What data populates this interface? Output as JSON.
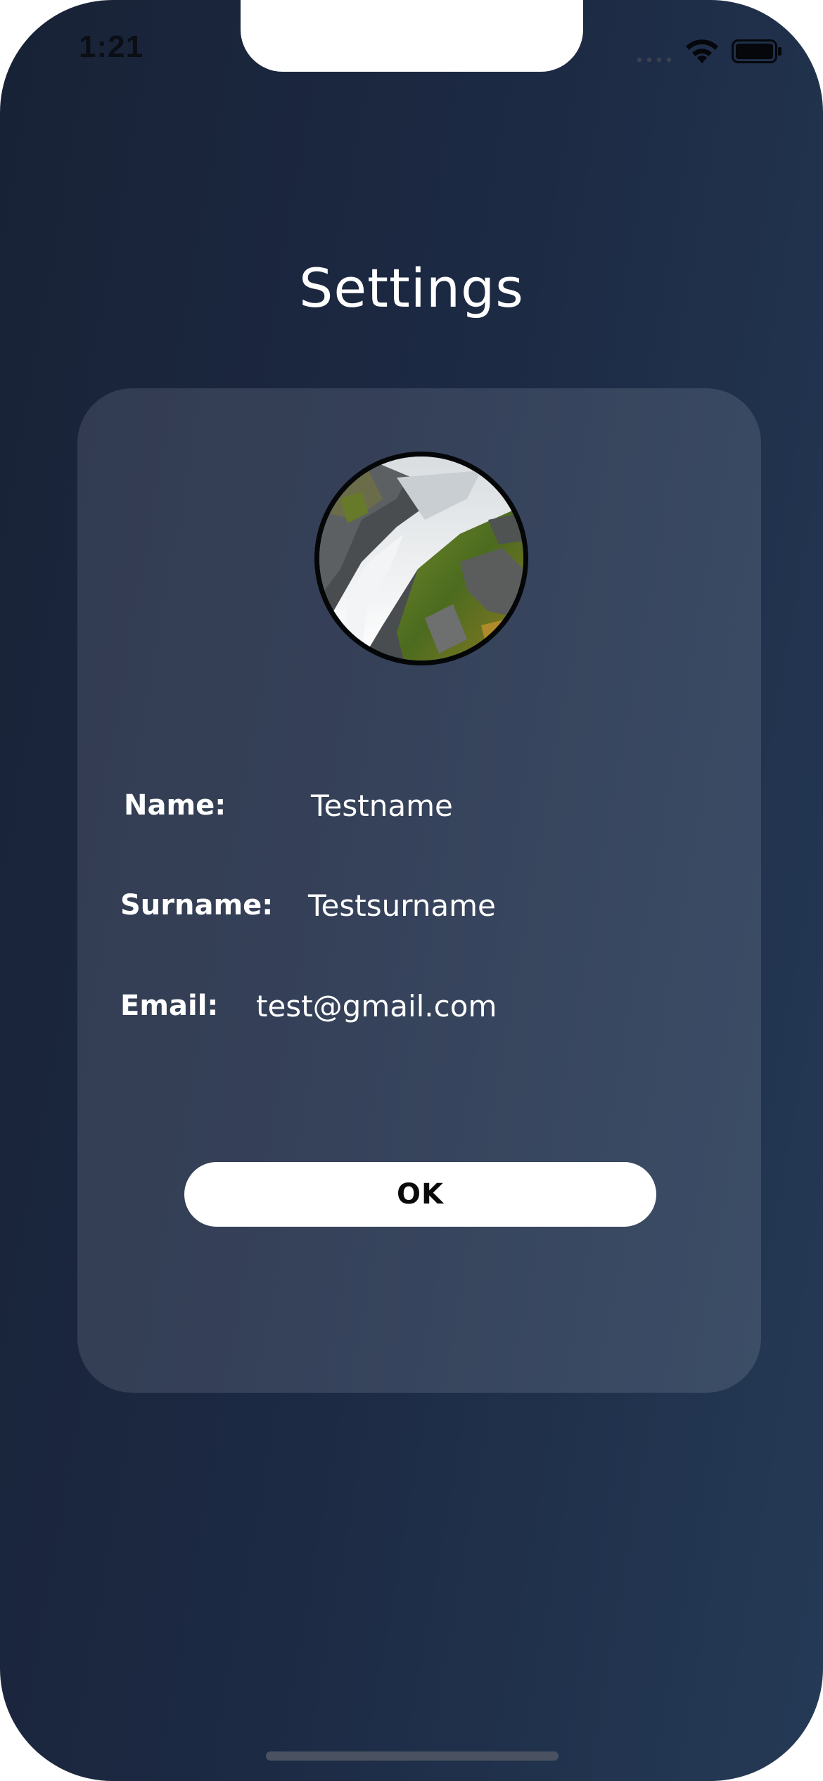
{
  "status_bar": {
    "time": "1:21",
    "icons": [
      "cellular-signal-icon",
      "wifi-icon",
      "battery-icon"
    ]
  },
  "header": {
    "title": "Settings"
  },
  "profile": {
    "avatar_image": "waterfall-photo"
  },
  "fields": {
    "name": {
      "label": "Name:",
      "value": "Testname"
    },
    "surname": {
      "label": "Surname:",
      "value": "Testsurname"
    },
    "email": {
      "label": "Email:",
      "value": "test@gmail.com"
    }
  },
  "actions": {
    "ok_label": "OK"
  },
  "colors": {
    "background_start": "#182236",
    "background_end": "#253a56",
    "card": "#3a455c",
    "button": "#ffffff",
    "text": "#ffffff"
  }
}
